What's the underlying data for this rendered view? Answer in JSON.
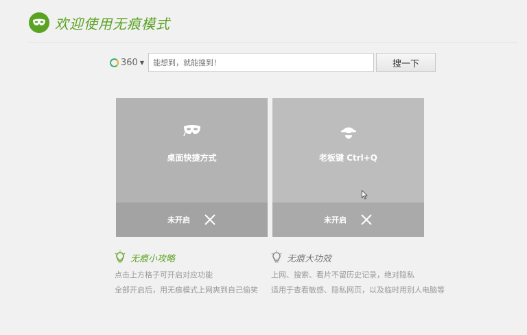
{
  "header": {
    "title": "欢迎使用无痕模式"
  },
  "search": {
    "engine": "360",
    "placeholder": "能想到，就能搜到！",
    "button_label": "搜一下"
  },
  "cards": [
    {
      "label": "桌面快捷方式",
      "status": "未开启",
      "icon": "mask-icon"
    },
    {
      "label": "老板键 Ctrl+Q",
      "status": "未开启",
      "icon": "boss-icon"
    }
  ],
  "tips": [
    {
      "title": "无痕小攻略",
      "lines": [
        "点击上方格子可开启对应功能",
        "全部开启后，用无痕模式上网爽到自己偷笑"
      ]
    },
    {
      "title": "无痕大功效",
      "lines": [
        "上网、搜索、看片不留历史记录，绝对隐私",
        "适用于查看敏感、隐私网页，以及临时用别人电脑等"
      ]
    }
  ],
  "colors": {
    "accent": "#5aa221",
    "card_bg": "#b3b3b3",
    "card_footer": "#a3a3a3"
  }
}
